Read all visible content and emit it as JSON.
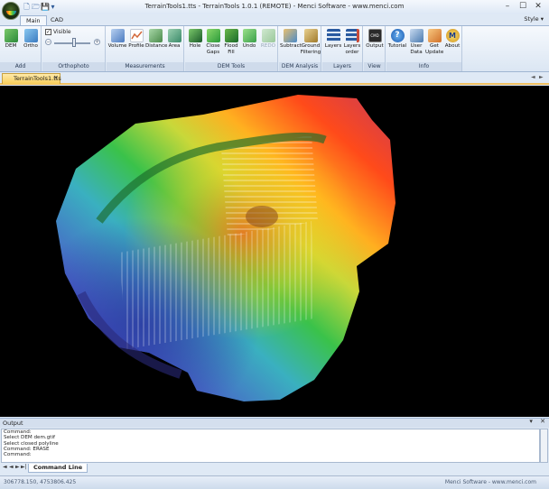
{
  "window": {
    "title": "TerrainTools1.tts - TerrainTools 1.0.1 (REMOTE) - Menci Software - www.menci.com",
    "minimize": "–",
    "maximize": "☐",
    "close": "✕"
  },
  "ribbon_tabs": [
    "Main",
    "CAD"
  ],
  "style_menu": "Style ▾",
  "groups": {
    "add": {
      "label": "Add",
      "buttons": [
        {
          "label": "DEM",
          "icon": "dem-add-icon",
          "color": "#3a9a4a"
        },
        {
          "label": "Ortho",
          "icon": "ortho-add-icon",
          "color": "#4a8ad0"
        }
      ]
    },
    "orthophoto": {
      "label": "Orthophoto",
      "visible_label": "Visible",
      "visible_checked": true,
      "minus": "−",
      "plus": "+",
      "opacity": 0.55
    },
    "measurements": {
      "label": "Measurements",
      "buttons": [
        {
          "label": "Volume",
          "icon": "volume-icon",
          "color": "#5a8ac8"
        },
        {
          "label": "Profile",
          "icon": "profile-icon",
          "color": "#d2683a"
        },
        {
          "label": "Distance",
          "icon": "distance-icon",
          "color": "#5a9a5a"
        },
        {
          "label": "Area",
          "icon": "area-icon",
          "color": "#4a9a7a"
        }
      ]
    },
    "dem_tools": {
      "label": "DEM Tools",
      "buttons": [
        {
          "label": "Hole",
          "icon": "hole-icon",
          "color": "#3a3a3a"
        },
        {
          "label": "Close Gaps",
          "icon": "close-gaps-icon",
          "color": "#3aa04a"
        },
        {
          "label": "Flood Fill",
          "icon": "flood-fill-icon",
          "color": "#2a8a3a"
        },
        {
          "label": "Undo",
          "icon": "undo-icon",
          "color": "#3aa04a"
        },
        {
          "label": "REDO",
          "icon": "redo-icon",
          "color": "#9ac89a",
          "disabled": true
        }
      ]
    },
    "dem_analysis": {
      "label": "DEM Analysis",
      "buttons": [
        {
          "label": "Subtract",
          "icon": "subtract-icon",
          "color": "#4a8ac8"
        },
        {
          "label": "Ground Filtering",
          "icon": "ground-filtering-icon",
          "color": "#c8a03a"
        }
      ]
    },
    "layers": {
      "label": "Layers",
      "buttons": [
        {
          "label": "Layers",
          "icon": "layers-icon",
          "color": "#2a5aa0"
        },
        {
          "label": "Layers order",
          "icon": "layers-order-icon",
          "color": "#c84a3a"
        }
      ]
    },
    "view": {
      "label": "View",
      "buttons": [
        {
          "label": "Output",
          "icon": "output-icon",
          "color": "#3a3a3a"
        }
      ]
    },
    "info": {
      "label": "Info",
      "buttons": [
        {
          "label": "Tutorial",
          "icon": "tutorial-icon",
          "color": "#2a7ad0"
        },
        {
          "label": "User Data",
          "icon": "user-data-icon",
          "color": "#4a7ab0"
        },
        {
          "label": "Get Update",
          "icon": "get-update-icon",
          "color": "#e8963a"
        },
        {
          "label": "About",
          "icon": "about-icon",
          "color": "#e0a020"
        }
      ]
    }
  },
  "document_tab": "TerrainTools1.tts",
  "document_tab_close": "×",
  "output": {
    "title": "Output",
    "pin": "▾",
    "close": "✕",
    "lines": [
      "Command:",
      " Select DEM  dem.gtif",
      " Select closed polyline",
      "Command:    ERASE",
      "Command:"
    ]
  },
  "bottom_tab": "Command Line",
  "nav_arrows": [
    "◄",
    "◄",
    "►",
    "►|"
  ],
  "status": {
    "coordinates": "306778.150, 4753806.425",
    "brand": "Menci Software - www.menci.com"
  },
  "colors": {
    "ribbon_bg": "#dbe6f3",
    "doc_tab": "#f8cf5c",
    "viewport_bg": "#000000",
    "elevation_low": "#3a2a8a",
    "elevation_mid": "#3ac24a",
    "elevation_high": "#ff4a1a"
  }
}
